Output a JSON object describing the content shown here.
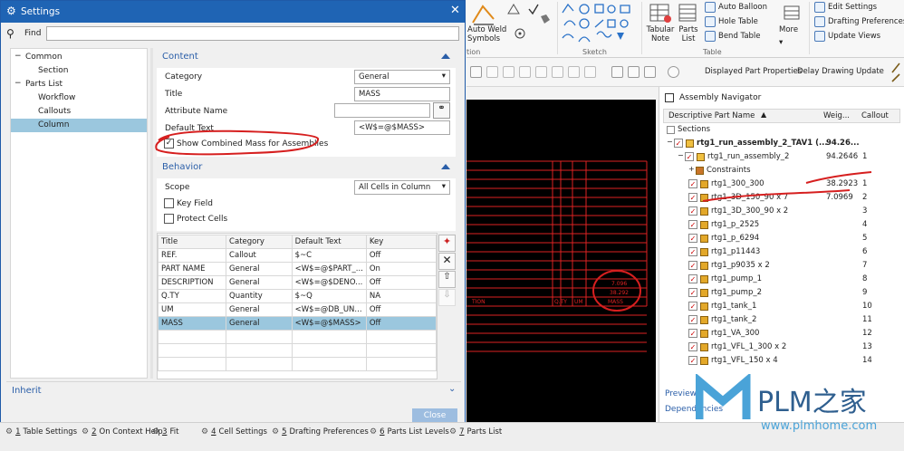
{
  "dialog": {
    "title": "Settings",
    "find_label": "Find",
    "tree": [
      {
        "label": "Common",
        "level": 0,
        "expander": "−"
      },
      {
        "label": "Section",
        "level": 1,
        "expander": ""
      },
      {
        "label": "Parts List",
        "level": 0,
        "expander": "−"
      },
      {
        "label": "Workflow",
        "level": 1,
        "expander": ""
      },
      {
        "label": "Callouts",
        "level": 1,
        "expander": ""
      },
      {
        "label": "Column",
        "level": 1,
        "expander": "",
        "selected": true
      }
    ],
    "inherit_label": "Inherit",
    "close_label": "Close",
    "content": {
      "header": "Content",
      "category_label": "Category",
      "category_value": "General",
      "title_label": "Title",
      "title_value": "MASS",
      "attribute_name_label": "Attribute Name",
      "attribute_name_value": "",
      "default_text_label": "Default Text",
      "default_text_value": "<W$=@$MASS>",
      "show_combined_label": "Show Combined Mass for Assemblies",
      "show_combined_checked": true
    },
    "behavior": {
      "header": "Behavior",
      "scope_label": "Scope",
      "scope_value": "All Cells in Column",
      "key_field_label": "Key Field",
      "protect_cells_label": "Protect Cells"
    },
    "grid": {
      "headers": [
        "Title",
        "Category",
        "Default Text",
        "Key"
      ],
      "rows": [
        [
          "REF.",
          "Callout",
          "$~C",
          "Off"
        ],
        [
          "PART NAME",
          "General",
          "<W$=@$PART_...",
          "On"
        ],
        [
          "DESCRIPTION",
          "General",
          "<W$=@$DENO...",
          "Off"
        ],
        [
          "Q.TY",
          "Quantity",
          "$~Q",
          "NA"
        ],
        [
          "UM",
          "General",
          "<W$=@DB_UN...",
          "Off"
        ],
        [
          "MASS",
          "General",
          "<W$=@$MASS>",
          "Off"
        ]
      ],
      "selected_row": 5
    }
  },
  "ribbon": {
    "auto_weld_symbols": "Auto Weld Symbols",
    "auto_balloon": "Auto Balloon",
    "hole_table": "Hole Table",
    "bend_table": "Bend Table",
    "tabular_note": "Tabular Note",
    "parts_list": "Parts List",
    "more": "More",
    "table_group": "Table",
    "sketch_group": "Sketch",
    "tion_group": "tion",
    "edit_settings": "Edit Settings",
    "drafting_preferences": "Drafting Preferences",
    "update_views": "Update Views"
  },
  "toolbar2": {
    "displayed_part_properties": "Displayed Part Properties",
    "delay_drawing_update": "Delay Drawing Update"
  },
  "navigator": {
    "title": "Assembly Navigator",
    "columns": [
      "Descriptive Part Name",
      "Weig...",
      "Callout"
    ],
    "rows": [
      {
        "name": "Sections",
        "weight": "",
        "callout": "",
        "indent": 0,
        "kind": "folder"
      },
      {
        "name": "rtg1_run_assembly_2_TAV1 (...",
        "weight": "94.26...",
        "callout": "",
        "indent": 0,
        "kind": "asm",
        "bold": true
      },
      {
        "name": "rtg1_run_assembly_2",
        "weight": "94.2646",
        "callout": "1",
        "indent": 1,
        "kind": "asm"
      },
      {
        "name": "Constraints",
        "weight": "",
        "callout": "",
        "indent": 2,
        "kind": "constraints"
      },
      {
        "name": "rtg1_300_300",
        "weight": "38.2923",
        "callout": "1",
        "indent": 2,
        "kind": "part"
      },
      {
        "name": "rtg1_3D_150_90 x 7",
        "weight": "7.0969",
        "callout": "2",
        "indent": 2,
        "kind": "part"
      },
      {
        "name": "rtg1_3D_300_90 x 2",
        "weight": "",
        "callout": "3",
        "indent": 2,
        "kind": "part"
      },
      {
        "name": "rtg1_p_2525",
        "weight": "",
        "callout": "4",
        "indent": 2,
        "kind": "part"
      },
      {
        "name": "rtg1_p_6294",
        "weight": "",
        "callout": "5",
        "indent": 2,
        "kind": "part"
      },
      {
        "name": "rtg1_p11443",
        "weight": "",
        "callout": "6",
        "indent": 2,
        "kind": "part"
      },
      {
        "name": "rtg1_p9035 x 2",
        "weight": "",
        "callout": "7",
        "indent": 2,
        "kind": "part"
      },
      {
        "name": "rtg1_pump_1",
        "weight": "",
        "callout": "8",
        "indent": 2,
        "kind": "part"
      },
      {
        "name": "rtg1_pump_2",
        "weight": "",
        "callout": "9",
        "indent": 2,
        "kind": "part"
      },
      {
        "name": "rtg1_tank_1",
        "weight": "",
        "callout": "10",
        "indent": 2,
        "kind": "part"
      },
      {
        "name": "rtg1_tank_2",
        "weight": "",
        "callout": "11",
        "indent": 2,
        "kind": "part"
      },
      {
        "name": "rtg1_VA_300",
        "weight": "",
        "callout": "12",
        "indent": 2,
        "kind": "part"
      },
      {
        "name": "rtg1_VFL_1_300 x 2",
        "weight": "",
        "callout": "13",
        "indent": 2,
        "kind": "part"
      },
      {
        "name": "rtg1_VFL_150 x 4",
        "weight": "",
        "callout": "14",
        "indent": 2,
        "kind": "part"
      }
    ],
    "preview_label": "Preview",
    "dependencies_label": "Dependencies"
  },
  "statusbar": [
    {
      "key": "1",
      "label": "Table Settings"
    },
    {
      "key": "2",
      "label": "On Context Help"
    },
    {
      "key": "3",
      "label": "Fit"
    },
    {
      "key": "4",
      "label": "Cell Settings"
    },
    {
      "key": "5",
      "label": "Drafting Preferences"
    },
    {
      "key": "6",
      "label": "Parts List Levels"
    },
    {
      "key": "7",
      "label": "Parts List"
    }
  ],
  "graphic": {
    "label_tion": "TION",
    "label_qty": "Q.TY",
    "label_um": "UM",
    "label_mass": "MASS",
    "value_a": "7.096",
    "value_b": "38.292"
  },
  "watermark": {
    "brand": "PLM之家",
    "url": "www.plmhome.com"
  }
}
